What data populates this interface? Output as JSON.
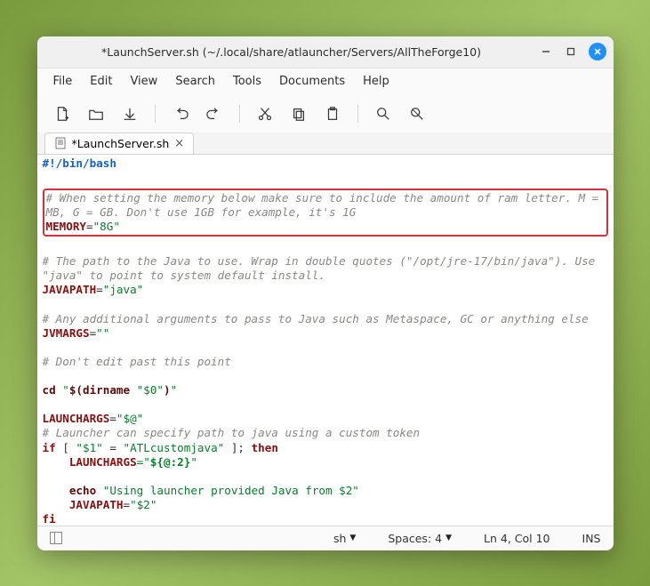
{
  "window": {
    "title": "*LaunchServer.sh (~/.local/share/atlauncher/Servers/AllTheForge10)"
  },
  "menu": {
    "file": "File",
    "edit": "Edit",
    "view": "View",
    "search": "Search",
    "tools": "Tools",
    "documents": "Documents",
    "help": "Help"
  },
  "tab": {
    "label": "*LaunchServer.sh"
  },
  "code": {
    "shebang": "#!/bin/bash",
    "c1a": "# When setting the memory below make sure to include the amount of ram letter. M = ",
    "c1b": "MB, G = GB. Don't use 1GB for example, it's 1G",
    "mem_var": "MEMORY",
    "eq": "=",
    "mem_val": "\"8G\"",
    "c2a": "# The path to the Java to use. Wrap in double quotes (\"/opt/jre-17/bin/java\"). Use ",
    "c2b": "\"java\" to point to system default install.",
    "jp_var": "JAVAPATH",
    "jp_val": "\"java\"",
    "c3": "# Any additional arguments to pass to Java such as Metaspace, GC or anything else",
    "ja_var": "JVMARGS",
    "ja_val": "\"\"",
    "c4": "# Don't edit past this point",
    "cd": "cd",
    "cd_arg_open": " \"",
    "cd_dirname": "$(dirname ",
    "cd_zero": "\"$0\"",
    "cd_close": ")",
    "cd_arg_close": "\"",
    "la_var": "LAUNCHARGS",
    "la_val": "\"$@\"",
    "c5": "# Launcher can specify path to java using a custom token",
    "if": "if",
    "if_br_open": " [ ",
    "if_one": "\"$1\"",
    "if_eq": " = ",
    "if_token": "\"ATLcustomjava\"",
    "if_br_close": " ]; ",
    "then": "then",
    "la2_var": "LAUNCHARGS",
    "la2_val_open": "=\"",
    "la2_val_inner": "${@:2}",
    "la2_val_close": "\"",
    "echo": "echo",
    "echo_str": " \"Using launcher provided Java from $2\"",
    "jp2_var": "JAVAPATH",
    "jp2_val": "\"$2\"",
    "fi": "fi",
    "indent": "    "
  },
  "status": {
    "lang": "sh",
    "spaces": "Spaces: 4",
    "pos": "Ln 4, Col 10",
    "mode": "INS"
  }
}
